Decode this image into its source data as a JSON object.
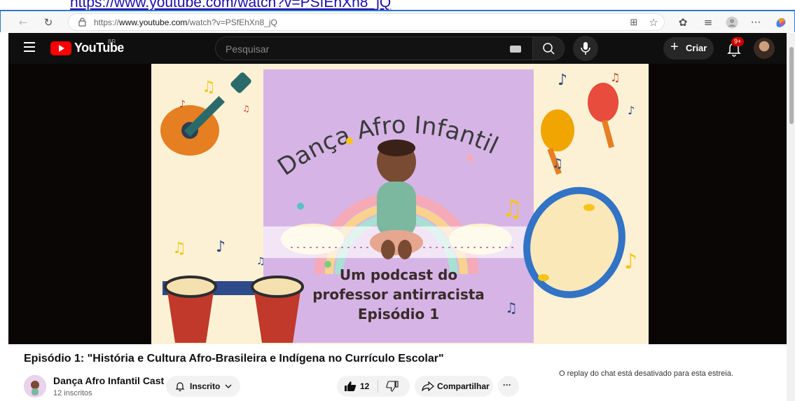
{
  "top_link": "https://www.youtube.com/watch?v=PSfEhXn8_jQ",
  "browser": {
    "url_prefix": "https://",
    "url_domain": "www.youtube.com",
    "url_rest": "/watch?v=PSfEhXn8_jQ"
  },
  "header": {
    "logo_text": "YouTube",
    "region": "BR",
    "search_placeholder": "Pesquisar",
    "create_label": "Criar",
    "notif_count": "9+"
  },
  "thumbnail": {
    "title": "Dança Afro Infantil",
    "line1": "Um podcast do",
    "line2": "professor antirracista",
    "line3": "Episódio 1"
  },
  "video": {
    "title": "Episódio 1: \"História e Cultura Afro-Brasileira e Indígena no Currículo Escolar\"",
    "channel_name": "Dança Afro Infantil Cast",
    "subscribers": "12 inscritos",
    "subscribe_label": "Inscrito",
    "likes": "12",
    "share_label": "Compartilhar",
    "more_label": "···"
  },
  "chat_note": "O replay do chat está desativado para esta estreia.",
  "colors": {
    "yt_red": "#ff0000",
    "header_bg": "#0f0f0f",
    "thumb_bg": "#fcf1d4",
    "purple": "#d6b5e6"
  }
}
